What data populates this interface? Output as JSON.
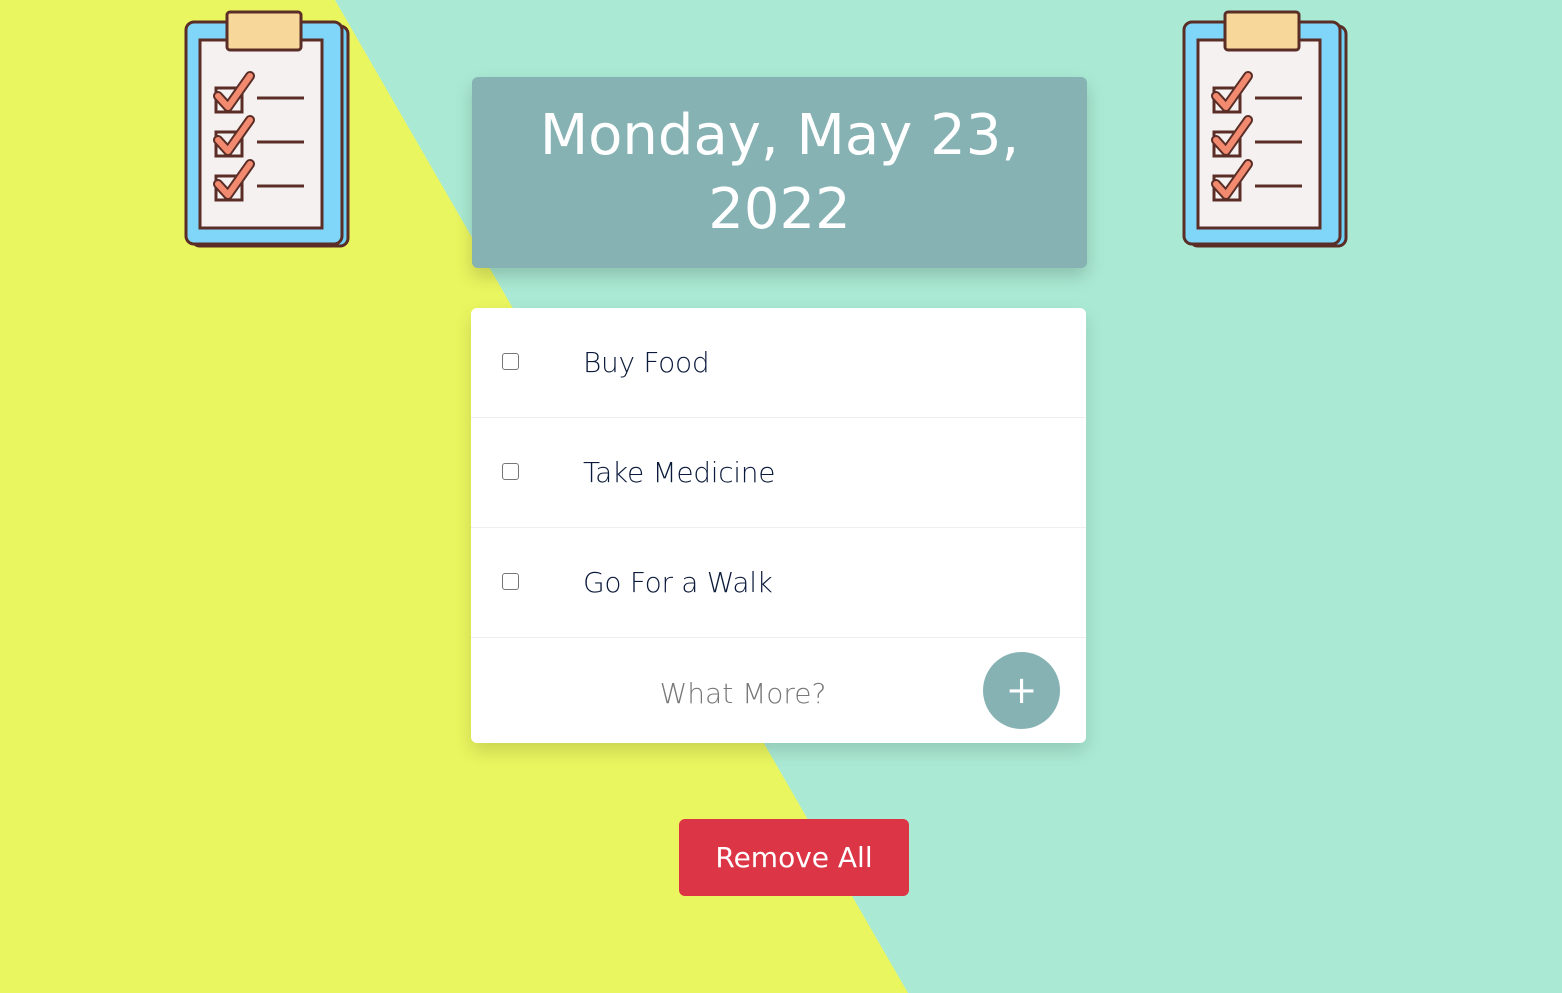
{
  "colors": {
    "background_yellow": "#eaf65f",
    "background_mint": "#aaead4",
    "header_bg": "#86b2b4",
    "card_bg": "#ffffff",
    "add_button_bg": "#86b2b4",
    "remove_button_bg": "#dc3545",
    "task_text": "#0b1a3a"
  },
  "decorations": {
    "left_icon": "clipboard-checklist-icon",
    "right_icon": "clipboard-checklist-icon"
  },
  "header": {
    "date_text": "Monday, May 23, 2022"
  },
  "todos": [
    {
      "label": "Buy Food",
      "checked": false
    },
    {
      "label": "Take Medicine",
      "checked": false
    },
    {
      "label": "Go For a Walk",
      "checked": false
    }
  ],
  "add_form": {
    "placeholder": "What More?",
    "button_label": "+"
  },
  "remove_all": {
    "label": "Remove All"
  }
}
